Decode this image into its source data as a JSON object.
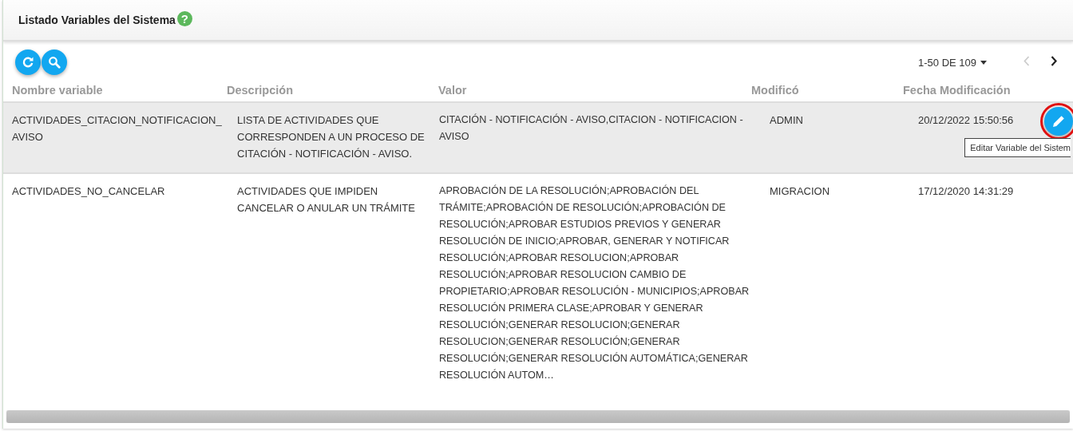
{
  "header": {
    "title": "Listado Variables del Sistema",
    "help": "?"
  },
  "pager": {
    "range": "1-50 DE 109",
    "prev_disabled": true,
    "next_disabled": false
  },
  "table": {
    "columns": [
      "Nombre variable",
      "Descripción",
      "Valor",
      "Modificó",
      "Fecha Modificación"
    ],
    "rows": [
      {
        "selected": true,
        "name": "ACTIVIDADES_CITACION_NOTIFICACION_AVISO",
        "description": "LISTA DE ACTIVIDADES QUE CORRESPONDEN A UN PROCESO DE CITACIÓN - NOTIFICACIÓN - AVISO.",
        "value": "CITACIÓN - NOTIFICACIÓN - AVISO,CITACION - NOTIFICACION - AVISO",
        "modified_by": "ADMIN",
        "modified_at": "20/12/2022 15:50:56"
      },
      {
        "selected": false,
        "name": "ACTIVIDADES_NO_CANCELAR",
        "description": "ACTIVIDADES QUE IMPIDEN CANCELAR O ANULAR UN TRÁMITE",
        "value": "APROBACIÓN DE LA RESOLUCIÓN;APROBACIÓN DEL TRÁMITE;APROBACIÓN DE RESOLUCIÓN;APROBACIÓN DE RESOLUCIÓN;APROBAR ESTUDIOS PREVIOS Y GENERAR RESOLUCIÓN DE INICIO;APROBAR, GENERAR Y NOTIFICAR RESOLUCIÓN;APROBAR RESOLUCION;APROBAR RESOLUCIÓN;APROBAR RESOLUCION CAMBIO DE PROPIETARIO;APROBAR RESOLUCIÓN - MUNICIPIOS;APROBAR RESOLUCIÓN PRIMERA CLASE;APROBAR Y GENERAR RESOLUCIÓN;GENERAR RESOLUCION;GENERAR RESOLUCION;GENERAR RESOLUCIÓN;GENERAR RESOLUCIÓN;GENERAR RESOLUCIÓN AUTOMÁTICA;GENERAR RESOLUCIÓN AUTOM…",
        "modified_by": "MIGRACION",
        "modified_at": "17/12/2020 14:31:29"
      }
    ]
  },
  "edit_button": {
    "highlighted": true,
    "tooltip": "Editar Variable del Sistem"
  }
}
